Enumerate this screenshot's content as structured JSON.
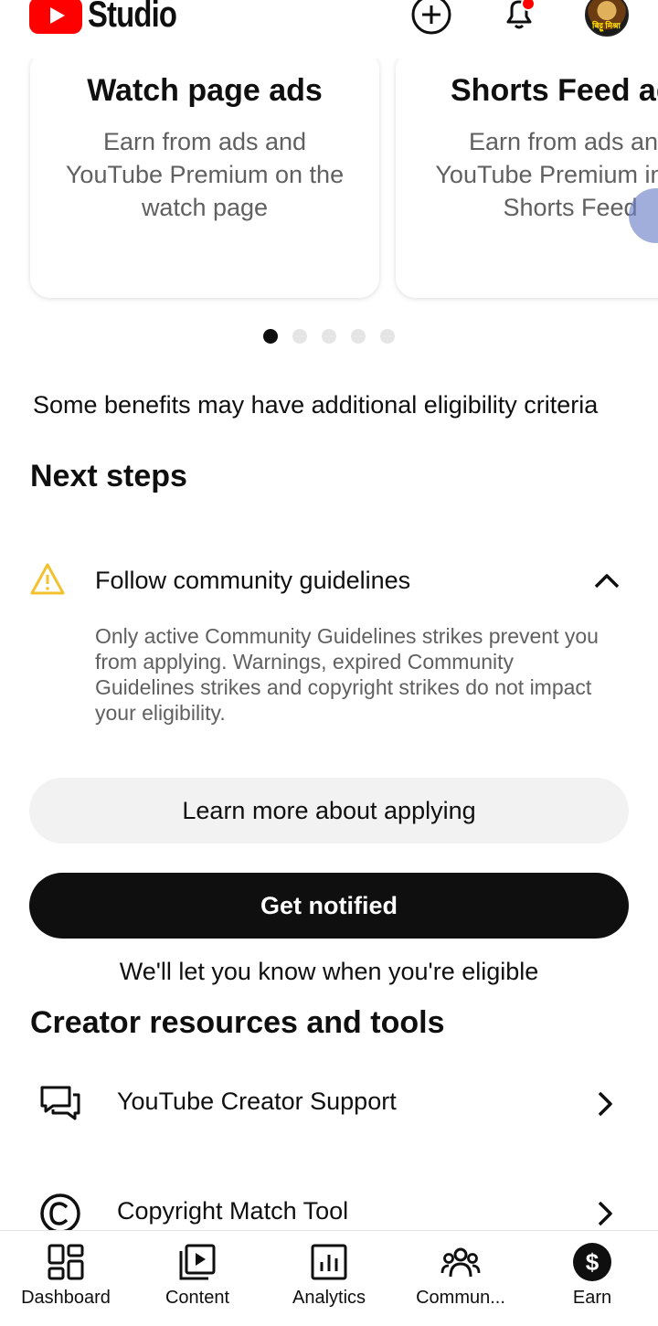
{
  "header": {
    "logo_text": "Studio",
    "avatar_text": "बिट्टू मिश्रा"
  },
  "carousel": {
    "cards": [
      {
        "title": "Watch page ads",
        "description": "Earn from ads and YouTube Premium on the watch page"
      },
      {
        "title": "Shorts Feed ads",
        "description": "Earn from ads and YouTube Premium in the Shorts Feed"
      }
    ],
    "page_count": 5,
    "active_page": 1
  },
  "eligibility_note": "Some benefits may have additional eligibility criteria",
  "next_steps": {
    "title": "Next steps",
    "item": {
      "title": "Follow community guidelines",
      "description": "Only active Community Guidelines strikes prevent you from applying. Warnings, expired Community Guidelines strikes and copyright strikes do not impact your eligibility.",
      "icon": "warning-icon",
      "expanded": true
    },
    "learn_more_label": "Learn more about applying",
    "notify_label": "Get notified",
    "notify_caption": "We'll let you know when you're eligible"
  },
  "creator_resources": {
    "title": "Creator resources and tools",
    "items": [
      {
        "label": "YouTube Creator Support",
        "icon": "chat-bubbles-icon"
      },
      {
        "label": "Copyright Match Tool",
        "icon": "copyright-icon"
      }
    ]
  },
  "bottom_nav": {
    "items": [
      {
        "label": "Dashboard",
        "icon": "dashboard-icon"
      },
      {
        "label": "Content",
        "icon": "content-icon"
      },
      {
        "label": "Analytics",
        "icon": "analytics-icon"
      },
      {
        "label": "Commun...",
        "icon": "community-icon"
      },
      {
        "label": "Earn",
        "icon": "earn-icon",
        "selected": true
      }
    ]
  },
  "colors": {
    "brand_red": "#ff0000",
    "warning_yellow": "#f2c12e",
    "primary_text": "#0f0f0f",
    "secondary_text": "#606060"
  }
}
